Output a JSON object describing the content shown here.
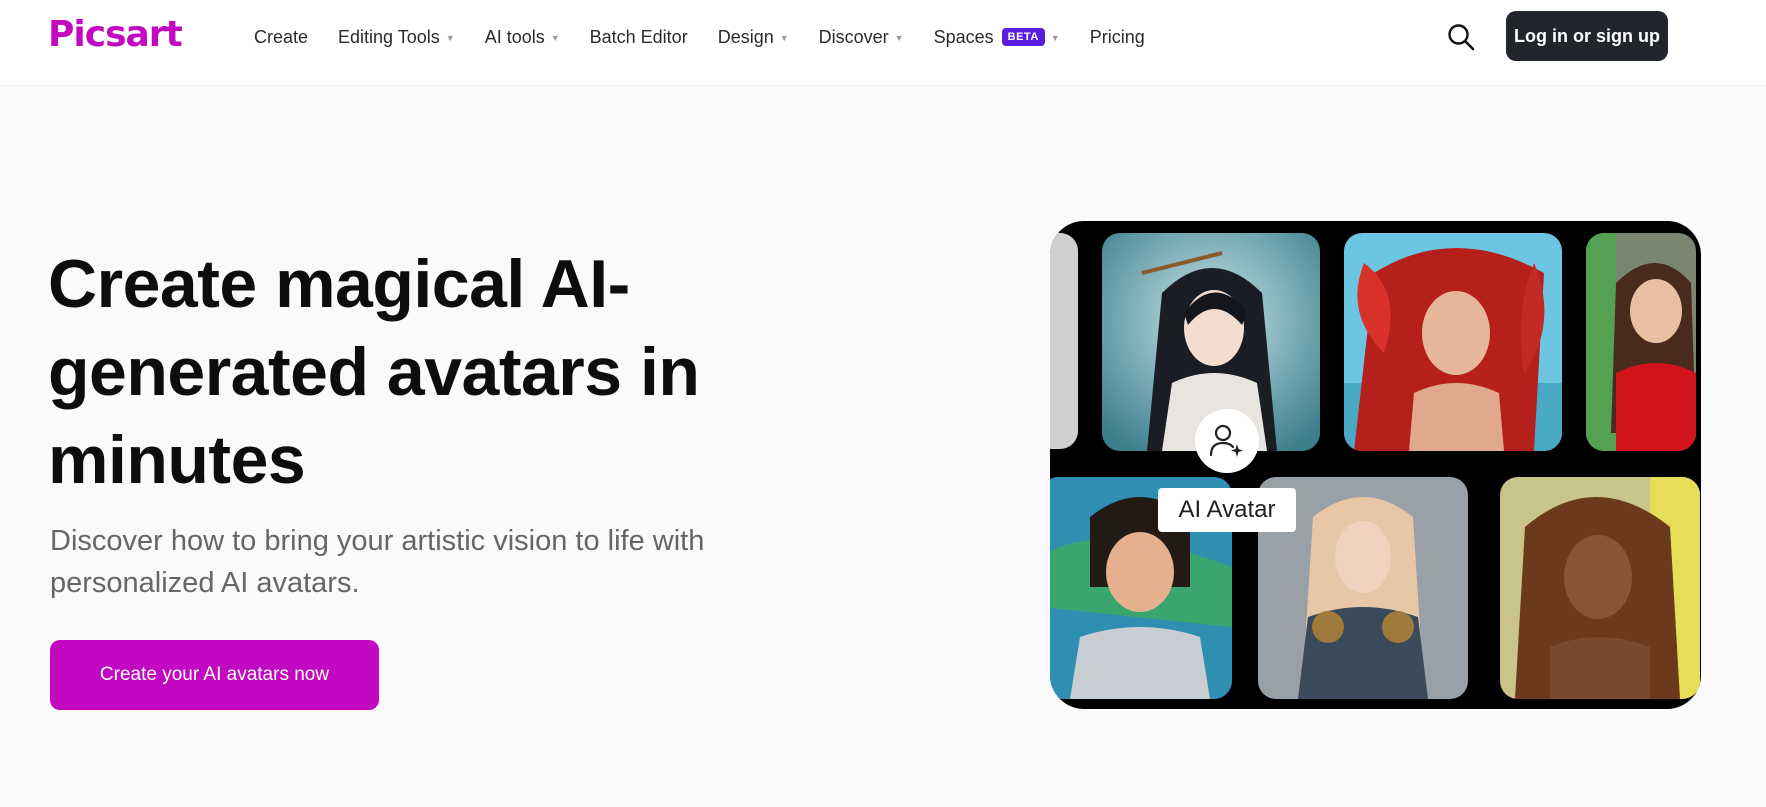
{
  "brand": {
    "logo_text": "Picsart",
    "accent_color": "#c209c1",
    "dark_color": "#22252b",
    "beta_color": "#5a1de0"
  },
  "nav": {
    "items": [
      {
        "label": "Create",
        "has_dropdown": false
      },
      {
        "label": "Editing Tools",
        "has_dropdown": true
      },
      {
        "label": "AI tools",
        "has_dropdown": true
      },
      {
        "label": "Batch Editor",
        "has_dropdown": false
      },
      {
        "label": "Design",
        "has_dropdown": true
      },
      {
        "label": "Discover",
        "has_dropdown": true
      },
      {
        "label": "Spaces",
        "badge": "BETA",
        "has_dropdown": true
      },
      {
        "label": "Pricing",
        "has_dropdown": false
      }
    ],
    "search_icon": "search-icon",
    "login_label": "Log in or sign up"
  },
  "hero": {
    "title": "Create magical AI-generated avatars in minutes",
    "subtitle": "Discover how to bring your artistic vision to life with personalized AI avatars.",
    "cta_label": "Create your AI avatars now"
  },
  "collage": {
    "badge_icon": "user-plus-sparkle-icon",
    "badge_label": "AI Avatar"
  }
}
